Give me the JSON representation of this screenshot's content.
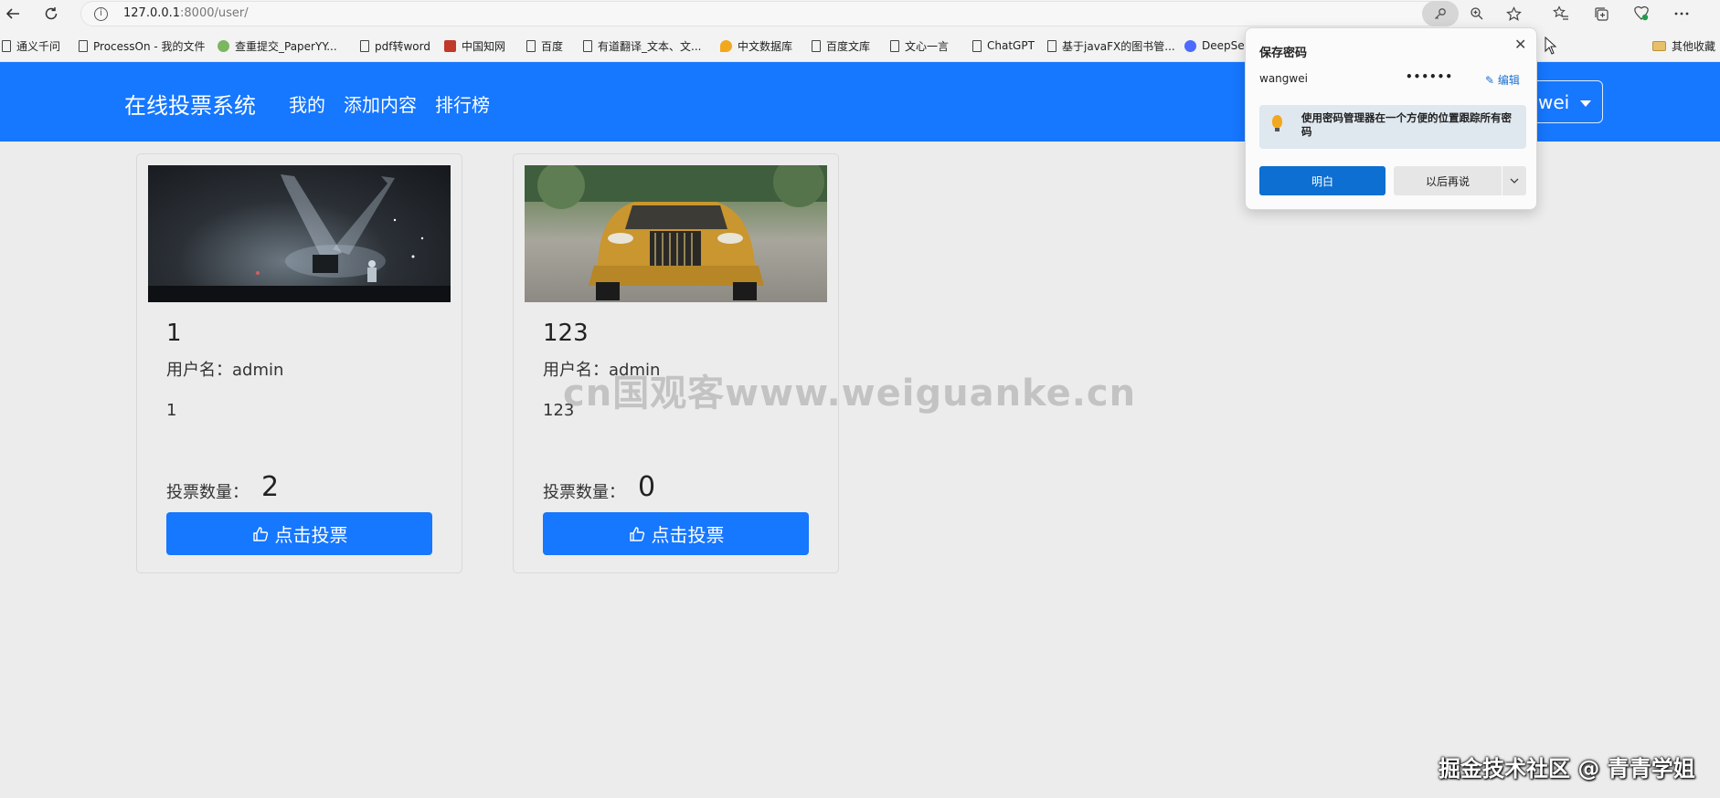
{
  "browser": {
    "url_host": "127.0.0.1",
    "url_path": ":8000/user/",
    "bookmarks": [
      {
        "label": "通义千问",
        "icon": "doc-icon"
      },
      {
        "label": "ProcessOn - 我的文件",
        "icon": "doc-icon"
      },
      {
        "label": "查重提交_PaperYY...",
        "icon": "paperyy-icon"
      },
      {
        "label": "pdf转word",
        "icon": "doc-icon"
      },
      {
        "label": "中国知网",
        "icon": "cnki-icon"
      },
      {
        "label": "百度",
        "icon": "doc-icon"
      },
      {
        "label": "有道翻译_文本、文...",
        "icon": "doc-icon"
      },
      {
        "label": "中文数据库",
        "icon": "location-icon"
      },
      {
        "label": "百度文库",
        "icon": "doc-icon"
      },
      {
        "label": "文心一言",
        "icon": "doc-icon"
      },
      {
        "label": "ChatGPT",
        "icon": "doc-icon"
      },
      {
        "label": "基于javaFX的图书管...",
        "icon": "doc-icon"
      },
      {
        "label": "DeepSe",
        "icon": "deepseek-icon"
      }
    ],
    "other_bookmarks": "其他收藏"
  },
  "navbar": {
    "brand": "在线投票系统",
    "links": [
      "我的",
      "添加内容",
      "排行榜"
    ],
    "user": "wei"
  },
  "cards": [
    {
      "title": "1",
      "owner": "用户名：admin",
      "desc": "1",
      "votes_label": "投票数量：",
      "votes": "2",
      "button": "点击投票",
      "image": "concert stage with spotlights"
    },
    {
      "title": "123",
      "owner": "用户名：admin",
      "desc": "123",
      "votes_label": "投票数量：",
      "votes": "0",
      "button": "点击投票",
      "image": "gold car"
    }
  ],
  "save_password_popup": {
    "title": "保存密码",
    "username": "wangwei",
    "password_mask": "••••••",
    "edit": "编辑",
    "tip": "使用密码管理器在一个方便的位置跟踪所有密码",
    "ok": "明白",
    "later": "以后再说"
  },
  "watermark": "cn国观客www.weiguanke.cn",
  "credit": "掘金技术社区 @ 青青学姐",
  "colors": {
    "primary": "#1677ff",
    "popup_ok": "#0c6fd1",
    "page_bg": "#ececec"
  }
}
